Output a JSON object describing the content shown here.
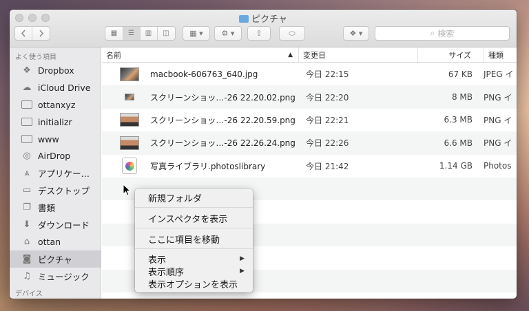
{
  "window": {
    "title": "ピクチャ"
  },
  "toolbar": {
    "search_placeholder": "検索"
  },
  "sidebar": {
    "favorites_header": "よく使う項目",
    "items": [
      {
        "label": "Dropbox",
        "icon": "dropbox-icon"
      },
      {
        "label": "iCloud Drive",
        "icon": "cloud-icon"
      },
      {
        "label": "ottanxyz",
        "icon": "folder-icon"
      },
      {
        "label": "initializr",
        "icon": "folder-icon"
      },
      {
        "label": "www",
        "icon": "folder-icon"
      },
      {
        "label": "AirDrop",
        "icon": "airdrop-icon"
      },
      {
        "label": "アプリケー…",
        "icon": "applications-icon"
      },
      {
        "label": "デスクトップ",
        "icon": "desktop-icon"
      },
      {
        "label": "書類",
        "icon": "documents-icon"
      },
      {
        "label": "ダウンロード",
        "icon": "download-icon"
      },
      {
        "label": "ottan",
        "icon": "home-icon"
      },
      {
        "label": "ピクチャ",
        "icon": "camera-icon",
        "selected": true
      },
      {
        "label": "ミュージック",
        "icon": "music-icon"
      }
    ],
    "devices_header": "デバイス"
  },
  "columns": {
    "name": "名前",
    "date": "変更日",
    "size": "サイズ",
    "kind": "種類"
  },
  "files": [
    {
      "name": "macbook-606763_640.jpg",
      "date": "今日 22:15",
      "size": "67 KB",
      "kind": "JPEG イ"
    },
    {
      "name": "スクリーンショッ…-26 22.20.02.png",
      "date": "今日 22:20",
      "size": "8 MB",
      "kind": "PNG イ"
    },
    {
      "name": "スクリーンショッ…-26 22.20.59.png",
      "date": "今日 22:21",
      "size": "6.3 MB",
      "kind": "PNG イ"
    },
    {
      "name": "スクリーンショッ…-26 22.26.24.png",
      "date": "今日 22:26",
      "size": "6.6 MB",
      "kind": "PNG イ"
    },
    {
      "name": "写真ライブラリ.photoslibrary",
      "date": "今日 21:42",
      "size": "1.14 GB",
      "kind": "Photos"
    }
  ],
  "context_menu": {
    "new_folder": "新規フォルダ",
    "inspector": "インスペクタを表示",
    "move_here": "ここに項目を移動",
    "view": "表示",
    "sort_by": "表示順序",
    "view_options": "表示オプションを表示"
  }
}
